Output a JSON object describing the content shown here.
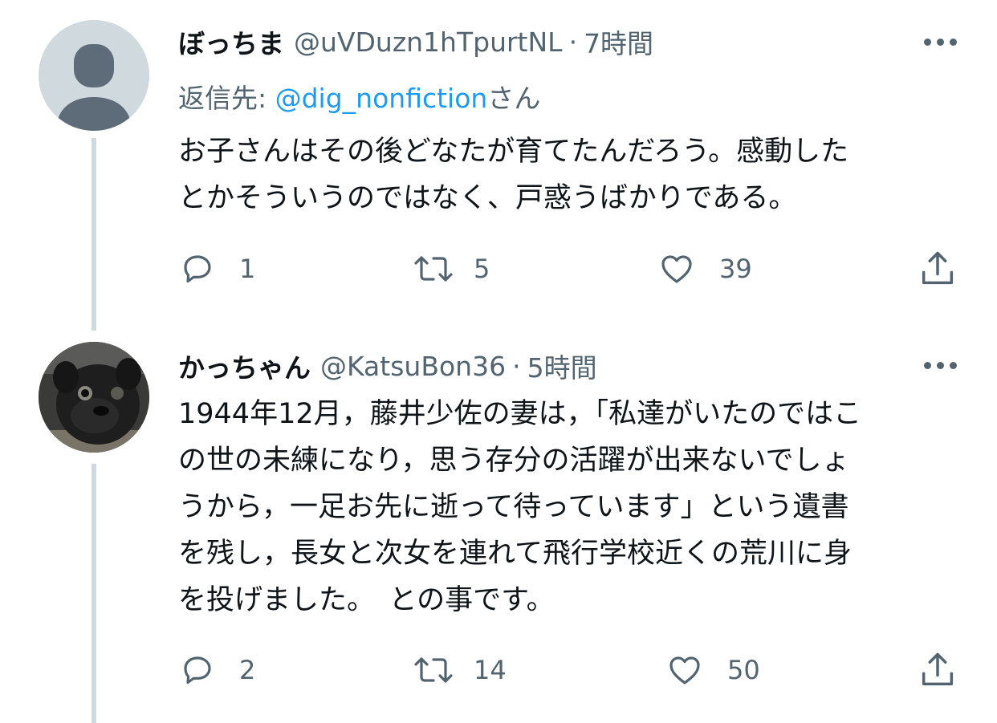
{
  "tweets": [
    {
      "display_name": "ぼっちま",
      "handle": "@uVDuzn1hTpurtNL",
      "separator": "·",
      "time": "7時間",
      "reply_prefix": "返信先: ",
      "reply_mention": "@dig_nonfiction",
      "reply_suffix": "さん",
      "text": "お子さんはその後どなたが育てたんだろう。感動した\nとかそういうのではなく、戸惑うばかりである。",
      "reply_count": "1",
      "retweet_count": "5",
      "like_count": "39",
      "avatar": "default-avatar-icon"
    },
    {
      "display_name": "かっちゃん",
      "handle": "@KatsuBon36",
      "separator": "·",
      "time": "5時間",
      "text": "1944年12月，藤井少佐の妻は，「私達がいたのではこ\nの世の未練になり，思う存分の活躍が出来ないでしょ\nうから，一足お先に逝って待っています」という遺書\nを残し，長女と次女を連れて飛行学校近くの荒川に身\nを投げました。　との事です。",
      "reply_count": "2",
      "retweet_count": "14",
      "like_count": "50",
      "avatar": "pug-photo"
    }
  ],
  "icons": {
    "reply": "reply-icon",
    "retweet": "retweet-icon",
    "like": "heart-icon",
    "share": "share-icon",
    "more": "more-icon"
  },
  "colors": {
    "text": "#0f1419",
    "secondary": "#536471",
    "link": "#1d9bf0",
    "thread_line": "#cfd9de",
    "avatar_placeholder_bg": "#cfd9de",
    "avatar_placeholder_fg": "#5e6b78"
  }
}
